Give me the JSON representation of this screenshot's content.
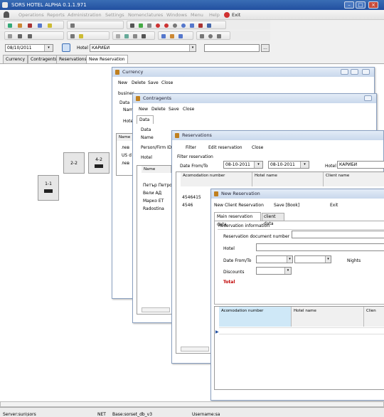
{
  "app": {
    "title": "SORS HOTEL ALPHA 0.1.1.971",
    "window_controls": [
      "minimize-icon",
      "maximize-icon",
      "close-icon"
    ]
  },
  "menu": {
    "items": [
      "Operations",
      "Reports",
      "Administration",
      "Settings",
      "Nomenclatures",
      "Windows",
      "Menu",
      "Help"
    ],
    "exit": "Exit"
  },
  "toolbar": {
    "date": "08/10/2011",
    "hotel_label": "Hotel",
    "hotel_value": "КАРИБИ",
    "ellipsis": "..."
  },
  "tabs": [
    "Currency",
    "Contragents",
    "Reservations",
    "New Reservation"
  ],
  "active_tab": "New Reservation",
  "rooms": [
    {
      "label": "1-1"
    },
    {
      "label": "2-2"
    },
    {
      "label": "4-2"
    }
  ],
  "currency": {
    "title": "Currency",
    "toolbar": [
      "New",
      "Delete",
      "Save",
      "Close"
    ],
    "frag_business": "busines",
    "frag_data": "Data",
    "frag_name": "Nam",
    "frag_hotel": "Hote",
    "col_name": "Name",
    "rows": [
      "лев",
      "US d",
      "лев"
    ]
  },
  "contragents": {
    "title": "Contragents",
    "toolbar": [
      "New",
      "Delete",
      "Save",
      "Close"
    ],
    "tab": "Data",
    "labels": [
      "Data",
      "Name",
      "Person/Firm ID",
      "Hotel"
    ],
    "col_name": "Name",
    "rows": [
      "Петър Петров",
      "Вели АД",
      "Марко ЕТ",
      "Radostina"
    ]
  },
  "reservations": {
    "title": "Reservations",
    "toolbar": [
      "Filter",
      "Edit reservation",
      "Close"
    ],
    "filter_label": "Filter reservation",
    "date_label": "Date From/To",
    "date_from": "08-10-2011",
    "date_to": "08-10-2011",
    "hotel_label": "Hotel",
    "hotel_value": "КАРИБИ",
    "columns": [
      "Acomodation number",
      "Hotel name",
      "Client name"
    ],
    "rows": [
      "4546415",
      "4546"
    ]
  },
  "new_reservation": {
    "title": "New Reservation",
    "toolbar": [
      "New Client Reservation",
      "Save [Book]",
      "Exit"
    ],
    "tabs": [
      "Main reservation data",
      "client data"
    ],
    "section": "Reservation information",
    "labels": {
      "doc_number": "Reservation document number",
      "hotel": "Hotel",
      "date": "Date From/To",
      "nights": "Nights",
      "discounts": "Discounts",
      "total": "Total"
    },
    "columns": [
      "Acomodation number",
      "Hotel name",
      "Clien"
    ]
  },
  "status": {
    "server": "Server:sun\\sors",
    "net": "NET",
    "base": "Base:sorset_db_v3",
    "username": "Username:sa"
  },
  "colors": {
    "titlebar": "#2a5ba8",
    "total_red": "#c00000",
    "selected_header": "#cfe8f7"
  }
}
